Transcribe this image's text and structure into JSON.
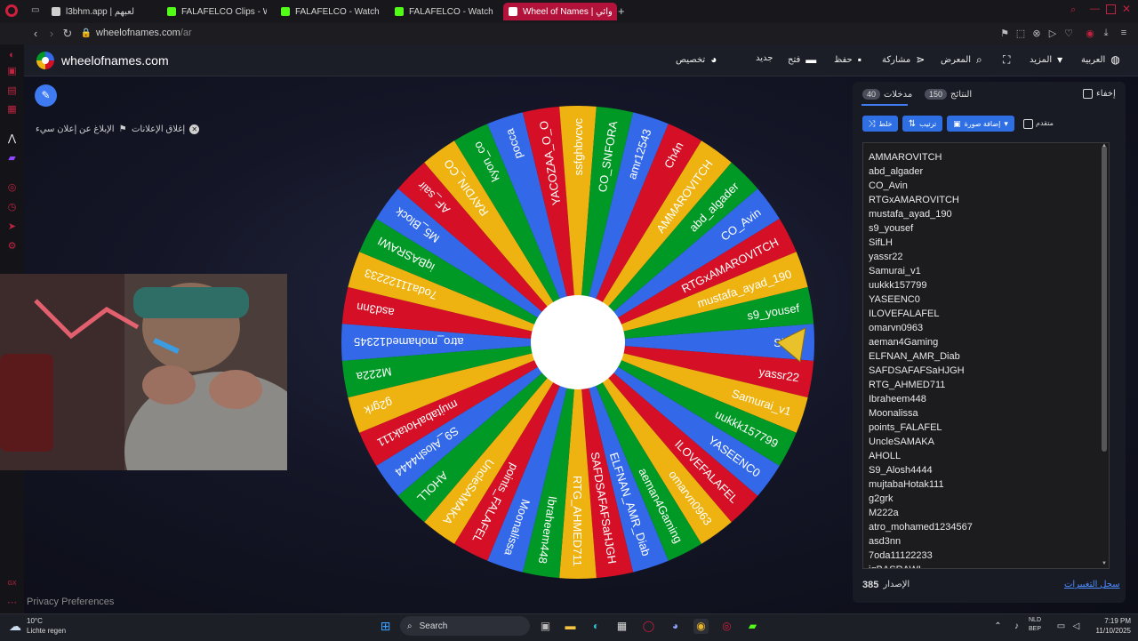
{
  "browser": {
    "tabs": [
      {
        "title": "l3bhm.app | لعبهم",
        "favicon_color": "#cfcfcf",
        "active": false
      },
      {
        "title": "FALAFELCO Clips - Watc",
        "favicon_color": "#53fc18",
        "active": false
      },
      {
        "title": "FALAFELCO - Watch clip",
        "favicon_color": "#53fc18",
        "active": false
      },
      {
        "title": "FALAFELCO - Watch clip",
        "favicon_color": "#53fc18",
        "active": false
      },
      {
        "title": "Wheel of Names | عشوائي",
        "favicon_color": "#ffffff",
        "active": true
      }
    ],
    "new_tab_icon": "+",
    "url_host": "wheelofnames.com",
    "url_path": "/ar"
  },
  "site": {
    "name": "wheelofnames.com",
    "nav": {
      "customize": "تخصيص",
      "new": "جديد",
      "open": "فتح",
      "save": "حفظ",
      "share": "مشاركة",
      "gallery": "المعرض",
      "more": "المزيد",
      "language": "العربية"
    },
    "close_ads": "إغلاق الإعلانات",
    "report_ad": "الإبلاغ عن إعلان سيء"
  },
  "wheel": {
    "colors": [
      "#3369e8",
      "#d50f25",
      "#eeb211",
      "#009925"
    ],
    "segments": [
      "SifLH",
      "yassr22",
      "Samurai_v1",
      "uukkk157799",
      "YASEENC0",
      "ILOVEFALAFEL",
      "omarvn0963",
      "aeman4Gaming",
      "ELFNAN_AMR_Diab",
      "SAFDSAFAFSaHJGH",
      "RTG_AHMED711",
      "Ibraheem448",
      "Moonalissa",
      "points_FALAFEL",
      "UncleSAMAKA",
      "AHOLL",
      "S9_Alosh4444",
      "mujtabaHotak111",
      "g2grk",
      "M222a",
      "atro_mohamed12345",
      "asd3nn",
      "7oda11122233",
      "iqBASRAWI",
      "M5_Block",
      "AF_sair",
      "RAYDIN_CO",
      "kyon_co",
      "pocca",
      "YACOZAA_O_O",
      "ssfghbvcvc",
      "CO_SNFORA",
      "amr12543",
      "Ch4n",
      "AMMAROVITCH",
      "abd_algader",
      "CO_Avin",
      "RTGxAMAROVITCH",
      "mustafa_ayad_190",
      "s9_yousef"
    ]
  },
  "panel": {
    "hide_label": "إخفاء",
    "tab_entries_label": "مدخلات",
    "tab_entries_count": "40",
    "tab_results_label": "النتائج",
    "tab_results_count": "150",
    "shuffle_label": "خلط",
    "sort_label": "ترتيب",
    "add_image_label": "إضافة صورة",
    "advanced_label": "متقدم",
    "entries": [
      "AMMAROVITCH",
      "abd_algader",
      "CO_Avin",
      "RTGxAMAROVITCH",
      "mustafa_ayad_190",
      "s9_yousef",
      "SifLH",
      "yassr22",
      "Samurai_v1",
      "uukkk157799",
      "YASEENC0",
      "ILOVEFALAFEL",
      "omarvn0963",
      "aeman4Gaming",
      "ELFNAN_AMR_Diab",
      "SAFDSAFAFSaHJGH",
      "RTG_AHMED711",
      "Ibraheem448",
      "Moonalissa",
      "points_FALAFEL",
      "UncleSAMAKA",
      "AHOLL",
      "S9_Alosh4444",
      "mujtabaHotak111",
      "g2grk",
      "M222a",
      "atro_mohamed1234567",
      "asd3nn",
      "7oda11122233",
      "iqBASRAWI"
    ],
    "version_label": "الإصدار",
    "version_number": "385",
    "changelog_link": "سجل التغييرات"
  },
  "privacy": "Privacy Preferences",
  "taskbar": {
    "weather_temp": "10°C",
    "weather_desc": "Lichte regen",
    "search_placeholder": "Search",
    "lang_line1": "NLD",
    "lang_line2": "BEP",
    "time": "7:19 PM",
    "date": "11/10/2025"
  }
}
